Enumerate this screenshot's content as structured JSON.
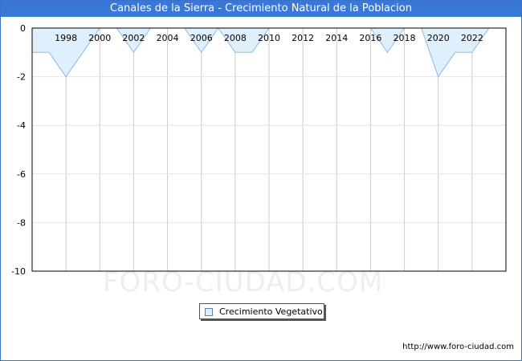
{
  "header": {
    "title": "Canales de la Sierra - Crecimiento Natural de la Poblacion"
  },
  "watermark": "FORO-CIUDAD.COM",
  "footer": {
    "url": "http://www.foro-ciudad.com"
  },
  "colors": {
    "fill": "#dff0fc",
    "stroke": "#8fb8e6",
    "title_bg": "#3a78d8",
    "grid": "#cccccc"
  },
  "chart_data": {
    "type": "area",
    "title": "Canales de la Sierra - Crecimiento Natural de la Poblacion",
    "x": [
      1996,
      1997,
      1998,
      1999,
      2000,
      2001,
      2002,
      2003,
      2004,
      2005,
      2006,
      2007,
      2008,
      2009,
      2010,
      2011,
      2012,
      2013,
      2014,
      2015,
      2016,
      2017,
      2018,
      2019,
      2020,
      2021,
      2022,
      2023
    ],
    "series": [
      {
        "name": "Crecimiento Vegetativo",
        "values": [
          -1,
          -1,
          -2,
          -1,
          0,
          0,
          -1,
          0,
          0,
          0,
          -1,
          0,
          -1,
          -1,
          0,
          0,
          0,
          0,
          0,
          0,
          0,
          -1,
          0,
          0,
          -2,
          -1,
          -1,
          0
        ]
      }
    ],
    "xticks": [
      "1998",
      "2000",
      "2002",
      "2004",
      "2006",
      "2008",
      "2010",
      "2012",
      "2014",
      "2016",
      "2018",
      "2020",
      "2022"
    ],
    "yticks": [
      "0",
      "-2",
      "-4",
      "-6",
      "-8",
      "-10"
    ],
    "ylim": [
      -10,
      0
    ],
    "xlim": [
      1996,
      2024
    ],
    "grid": true,
    "legend": {
      "position": "bottom-center",
      "label": "Crecimiento Vegetativo"
    }
  }
}
